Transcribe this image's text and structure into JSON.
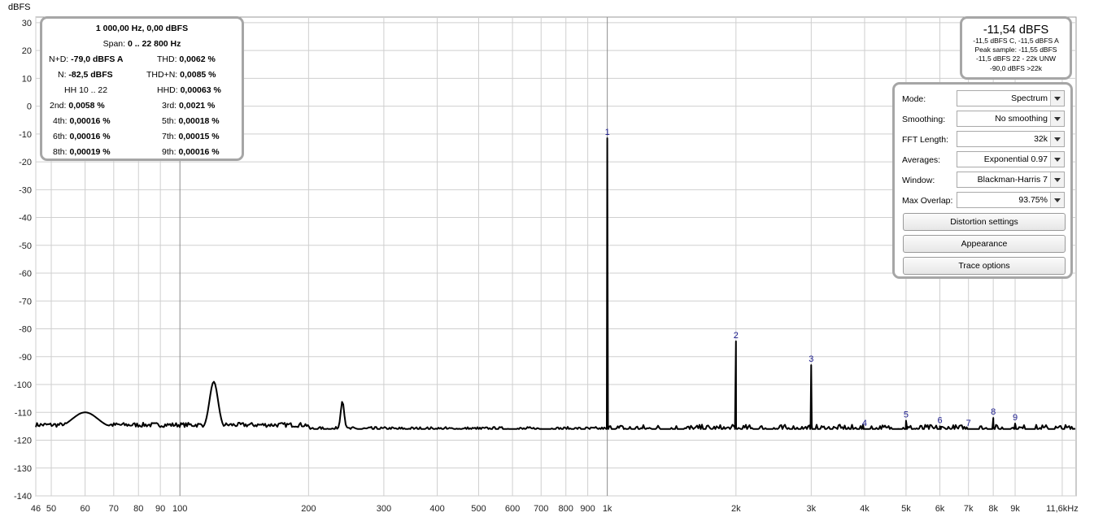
{
  "chart_data": {
    "type": "line",
    "title": "",
    "ylabel": "dBFS",
    "xlabel": "",
    "x_scale": "log",
    "xlim": [
      46,
      12500
    ],
    "ylim": [
      -140,
      32
    ],
    "y_ticks": [
      30,
      20,
      10,
      0,
      -10,
      -20,
      -30,
      -40,
      -50,
      -60,
      -70,
      -80,
      -90,
      -100,
      -110,
      -120,
      -130,
      -140
    ],
    "x_ticks": [
      {
        "v": 46,
        "label": "46"
      },
      {
        "v": 50,
        "label": "50"
      },
      {
        "v": 60,
        "label": "60"
      },
      {
        "v": 70,
        "label": "70"
      },
      {
        "v": 80,
        "label": "80"
      },
      {
        "v": 90,
        "label": "90"
      },
      {
        "v": 100,
        "label": "100"
      },
      {
        "v": 200,
        "label": "200"
      },
      {
        "v": 300,
        "label": "300"
      },
      {
        "v": 400,
        "label": "400"
      },
      {
        "v": 500,
        "label": "500"
      },
      {
        "v": 600,
        "label": "600"
      },
      {
        "v": 700,
        "label": "700"
      },
      {
        "v": 800,
        "label": "800"
      },
      {
        "v": 900,
        "label": "900"
      },
      {
        "v": 1000,
        "label": "1k"
      },
      {
        "v": 2000,
        "label": "2k"
      },
      {
        "v": 3000,
        "label": "3k"
      },
      {
        "v": 4000,
        "label": "4k"
      },
      {
        "v": 5000,
        "label": "5k"
      },
      {
        "v": 6000,
        "label": "6k"
      },
      {
        "v": 7000,
        "label": "7k"
      },
      {
        "v": 8000,
        "label": "8k"
      },
      {
        "v": 9000,
        "label": "9k"
      },
      {
        "v": 11600,
        "label": "11,6kHz"
      }
    ],
    "grid": true,
    "baseline_db": -116,
    "features": [
      {
        "f": 60,
        "db": -110,
        "width": 0.06
      },
      {
        "f": 120,
        "db": -99,
        "width": 0.02
      },
      {
        "f": 240,
        "db": -106,
        "width": 0.008
      }
    ],
    "harmonics": [
      {
        "n": "1",
        "f": 1000,
        "db": -11.5
      },
      {
        "n": "2",
        "f": 2000,
        "db": -84.5
      },
      {
        "n": "3",
        "f": 3000,
        "db": -93
      },
      {
        "n": "4",
        "f": 4000,
        "db": -116
      },
      {
        "n": "5",
        "f": 5000,
        "db": -113
      },
      {
        "n": "6",
        "f": 6000,
        "db": -115
      },
      {
        "n": "7",
        "f": 7000,
        "db": -116
      },
      {
        "n": "8",
        "f": 8000,
        "db": -112
      },
      {
        "n": "9",
        "f": 9000,
        "db": -114
      }
    ],
    "trace_color": "#000000",
    "grid_color": "#cfcfcf"
  },
  "distortion": {
    "header": "1 000,00 Hz, 0,00 dBFS",
    "span_label": "Span:",
    "span_value": "0 .. 22 800 Hz",
    "nd_label": "N+D:",
    "nd_value": "-79,0 dBFS A",
    "thd_label": "THD:",
    "thd_value": "0,0062 %",
    "n_label": "N:",
    "n_value": "-82,5 dBFS",
    "thdn_label": "THD+N:",
    "thdn_value": "0,0085 %",
    "hh_label": "HH 10 .. 22",
    "hhd_label": "HHD:",
    "hhd_value": "0,00063 %",
    "h2_label": "2nd:",
    "h2_value": "0,0058 %",
    "h3_label": "3rd:",
    "h3_value": "0,0021 %",
    "h4_label": "4th:",
    "h4_value": "0,00016 %",
    "h5_label": "5th:",
    "h5_value": "0,00018 %",
    "h6_label": "6th:",
    "h6_value": "0,00016 %",
    "h7_label": "7th:",
    "h7_value": "0,00015 %",
    "h8_label": "8th:",
    "h8_value": "0,00019 %",
    "h9_label": "9th:",
    "h9_value": "0,00016 %"
  },
  "level": {
    "main": "-11,54 dBFS",
    "line1": "-11,5 dBFS C, -11,5 dBFS A",
    "line2": "Peak sample: -11,55 dBFS",
    "line3": "-11,5 dBFS 22 - 22k UNW",
    "line4": "-90,0 dBFS >22k"
  },
  "controls": {
    "mode_label": "Mode:",
    "mode_value": "Spectrum",
    "smoothing_label": "Smoothing:",
    "smoothing_value": "No  smoothing",
    "fft_label": "FFT Length:",
    "fft_value": "32k",
    "averages_label": "Averages:",
    "averages_value": "Exponential 0.97",
    "window_label": "Window:",
    "window_value": "Blackman-Harris 7",
    "overlap_label": "Max Overlap:",
    "overlap_value": "93.75%",
    "distortion_btn": "Distortion settings",
    "appearance_btn": "Appearance",
    "trace_btn": "Trace options"
  }
}
